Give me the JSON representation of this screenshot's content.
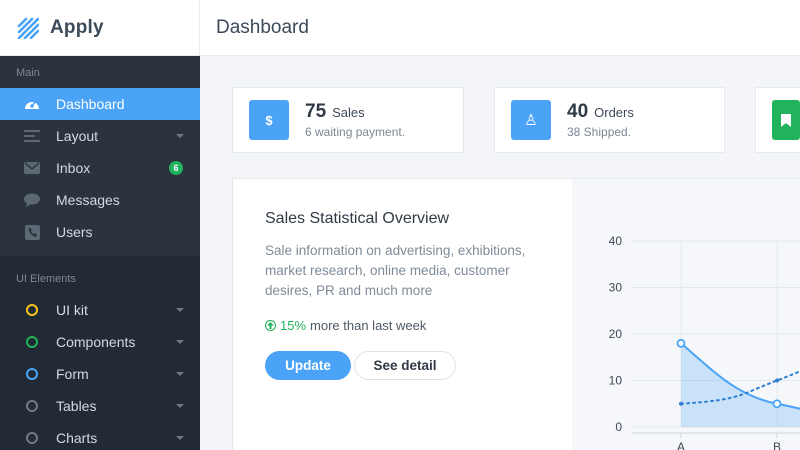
{
  "brand": {
    "name": "Apply"
  },
  "header": {
    "title": "Dashboard"
  },
  "sidebar": {
    "main_label": "Main",
    "main_items": [
      {
        "label": "Dashboard",
        "icon": "dashboard-icon",
        "active": true
      },
      {
        "label": "Layout",
        "icon": "layout-icon",
        "caret": true
      },
      {
        "label": "Inbox",
        "icon": "mail-icon",
        "badge": "6"
      },
      {
        "label": "Messages",
        "icon": "chat-icon"
      },
      {
        "label": "Users",
        "icon": "users-icon"
      }
    ],
    "ui_label": "UI Elements",
    "ui_items": [
      {
        "label": "UI kit",
        "color": "#f5c518"
      },
      {
        "label": "Components",
        "color": "#21b35b"
      },
      {
        "label": "Form",
        "color": "#4aa3f7"
      },
      {
        "label": "Tables",
        "color": "#6f7a86"
      },
      {
        "label": "Charts",
        "color": "#6f7a86"
      }
    ]
  },
  "stats": [
    {
      "value": "75",
      "label": "Sales",
      "sub": "6 waiting payment.",
      "icon": "dollar-icon",
      "glyph": "$",
      "color": "#4aa3f7"
    },
    {
      "value": "40",
      "label": "Orders",
      "sub": "38 Shipped.",
      "icon": "person-icon",
      "glyph": "♙",
      "color": "#4aa3f7"
    },
    {
      "value": "",
      "label": "",
      "sub": "",
      "icon": "bookmark-icon",
      "glyph": "",
      "color": "#21b35b"
    }
  ],
  "overview": {
    "title": "Sales Statistical Overview",
    "description": "Sale information on advertising, exhibitions, market research, online media, customer desires, PR and much more",
    "growth_pct": "15%",
    "growth_text": "more than last week",
    "update_label": "Update",
    "detail_label": "See detail"
  },
  "chart_data": {
    "type": "line",
    "categories": [
      "A",
      "B"
    ],
    "ylim": [
      0,
      40
    ],
    "yticks": [
      0,
      10,
      20,
      30,
      40
    ],
    "series": [
      {
        "values": [
          18,
          5
        ],
        "style": "solid-area",
        "color": "#4aa3f7"
      },
      {
        "values": [
          5,
          10
        ],
        "style": "dotted",
        "color": "#2f7fd4"
      }
    ]
  }
}
